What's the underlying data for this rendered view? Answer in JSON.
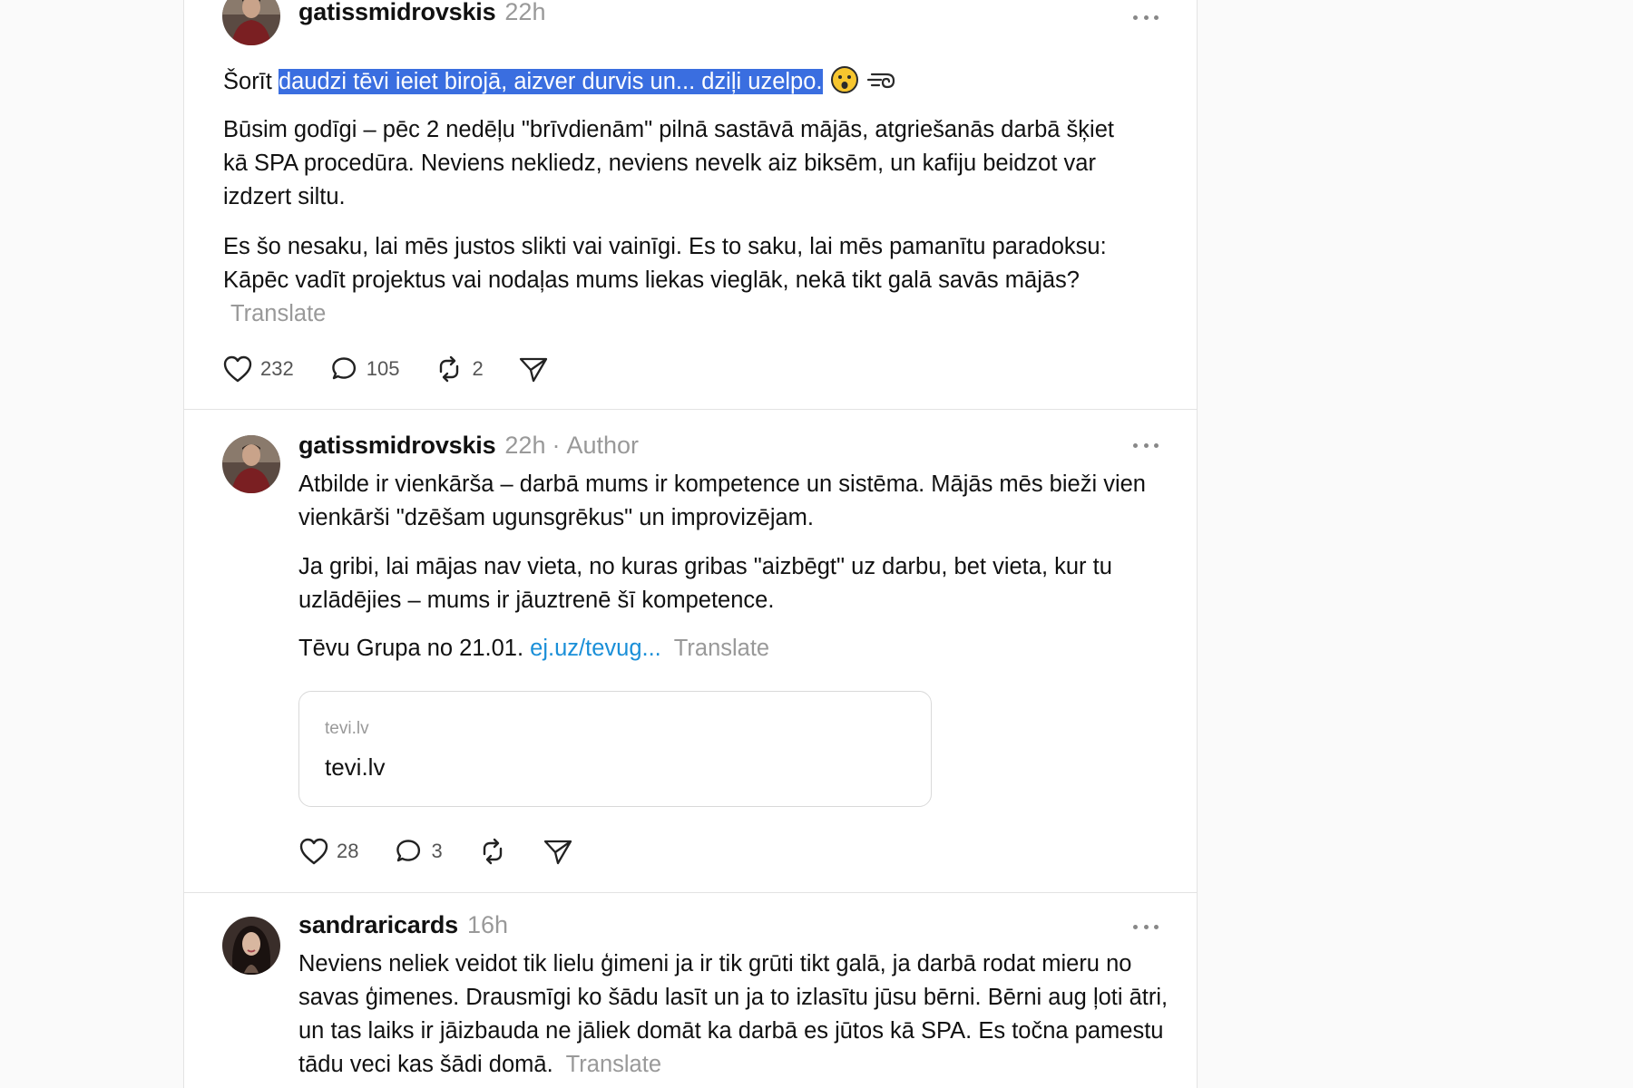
{
  "posts": [
    {
      "username": "gatissmidrovskis",
      "time": "22h",
      "lead": "Šorīt ",
      "highlighted": "daudzi tēvi ieiet birojā, aizver durvis un... dziļi uzelpo.",
      "emojis": [
        "astonished-face-emoji",
        "dashing-away-emoji"
      ],
      "paragraphs": [
        "Būsim godīgi – pēc 2 nedēļu \"brīvdienām\" pilnā sastāvā mājās, atgriešanās darbā šķiet kā SPA procedūra. Neviens nekliedz, neviens nevelk aiz biksēm, un kafiju beidzot var izdzert siltu.",
        "Es šo nesaku, lai mēs justos slikti vai vainīgi. Es to saku, lai mēs pamanītu paradoksu: Kāpēc vadīt projektus vai nodaļas mums liekas vieglāk, nekā tikt galā savās mājās?"
      ],
      "translate": "Translate",
      "likes": "232",
      "replies": "105",
      "reposts": "2"
    },
    {
      "username": "gatissmidrovskis",
      "time": "22h",
      "separator": "·",
      "author_tag": "Author",
      "paragraphs": [
        "Atbilde ir vienkārša – darbā mums ir kompetence un sistēma. Mājās mēs bieži vien vienkārši \"dzēšam ugunsgrēkus\" un improvizējam.",
        "Ja gribi, lai mājas nav vieta, no kuras gribas \"aizbēgt\" uz darbu, bet vieta, kur tu uzlādējies – mums ir jāuztrenē šī kompetence."
      ],
      "last_line_text": "Tēvu Grupa no 21.01. ",
      "link_text": "ej.uz/tevug...",
      "translate": "Translate",
      "card": {
        "domain": "tevi.lv",
        "title": "tevi.lv"
      },
      "likes": "28",
      "replies": "3"
    },
    {
      "username": "sandraricards",
      "time": "16h",
      "text": "Neviens neliek veidot tik lielu ģimeni ja ir tik grūti tikt galā, ja darbā rodat mieru no savas ģimenes. Drausmīgi ko šādu lasīt un ja to izlasītu jūsu bērni. Bērni aug ļoti ātri, un tas laiks ir jāizbauda ne jāliek domāt ka darbā es jūtos kā SPA. Es točna pamestu tādu veci kas šādi domā.",
      "translate": "Translate"
    }
  ],
  "colors": {
    "highlight": "#3a6ee0",
    "link": "#1a8fd8",
    "muted": "#999999"
  }
}
